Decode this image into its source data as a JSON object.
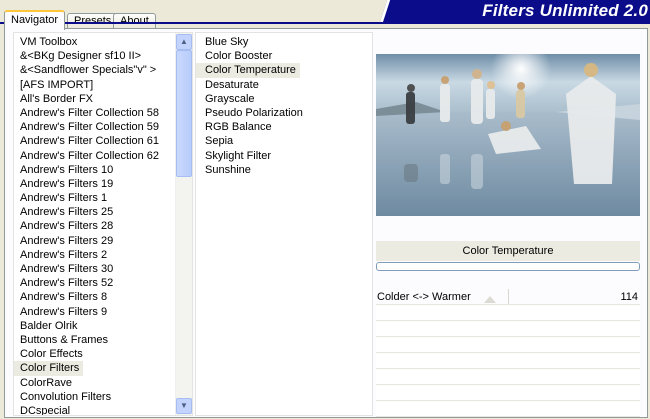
{
  "tabs": [
    {
      "label": "Navigator",
      "active": true
    },
    {
      "label": "Presets",
      "active": false
    },
    {
      "label": "About",
      "active": false
    }
  ],
  "banner": {
    "title": "Filters Unlimited 2.0",
    "color": "#0a0c8a"
  },
  "categories": [
    "VM Toolbox",
    "&<BKg Designer sf10 II>",
    "&<Sandflower Specials\"v\" >",
    "[AFS IMPORT]",
    "All's Border FX",
    "Andrew's Filter Collection 58",
    "Andrew's Filter Collection 59",
    "Andrew's Filter Collection 61",
    "Andrew's Filter Collection 62",
    "Andrew's Filters 10",
    "Andrew's Filters 19",
    "Andrew's Filters 1",
    "Andrew's Filters 25",
    "Andrew's Filters 28",
    "Andrew's Filters 29",
    "Andrew's Filters 2",
    "Andrew's Filters 30",
    "Andrew's Filters 52",
    "Andrew's Filters 8",
    "Andrew's Filters 9",
    "Balder Olrik",
    "Buttons & Frames",
    "Color Effects",
    "Color Filters",
    "ColorRave",
    "Convolution Filters",
    "DCspecial"
  ],
  "selected_category_index": 23,
  "filters": [
    "Blue Sky",
    "Color Booster",
    "Color Temperature",
    "Desaturate",
    "Grayscale",
    "Pseudo Polarization",
    "RGB Balance",
    "Sepia",
    "Skylight Filter",
    "Sunshine"
  ],
  "selected_filter_index": 2,
  "preview": {
    "current_filter": "Color Temperature",
    "progress": 0
  },
  "params": [
    {
      "label": "Colder <-> Warmer",
      "value": "114"
    }
  ],
  "icons": {
    "scroll_up": "▲",
    "scroll_down": "▼"
  }
}
